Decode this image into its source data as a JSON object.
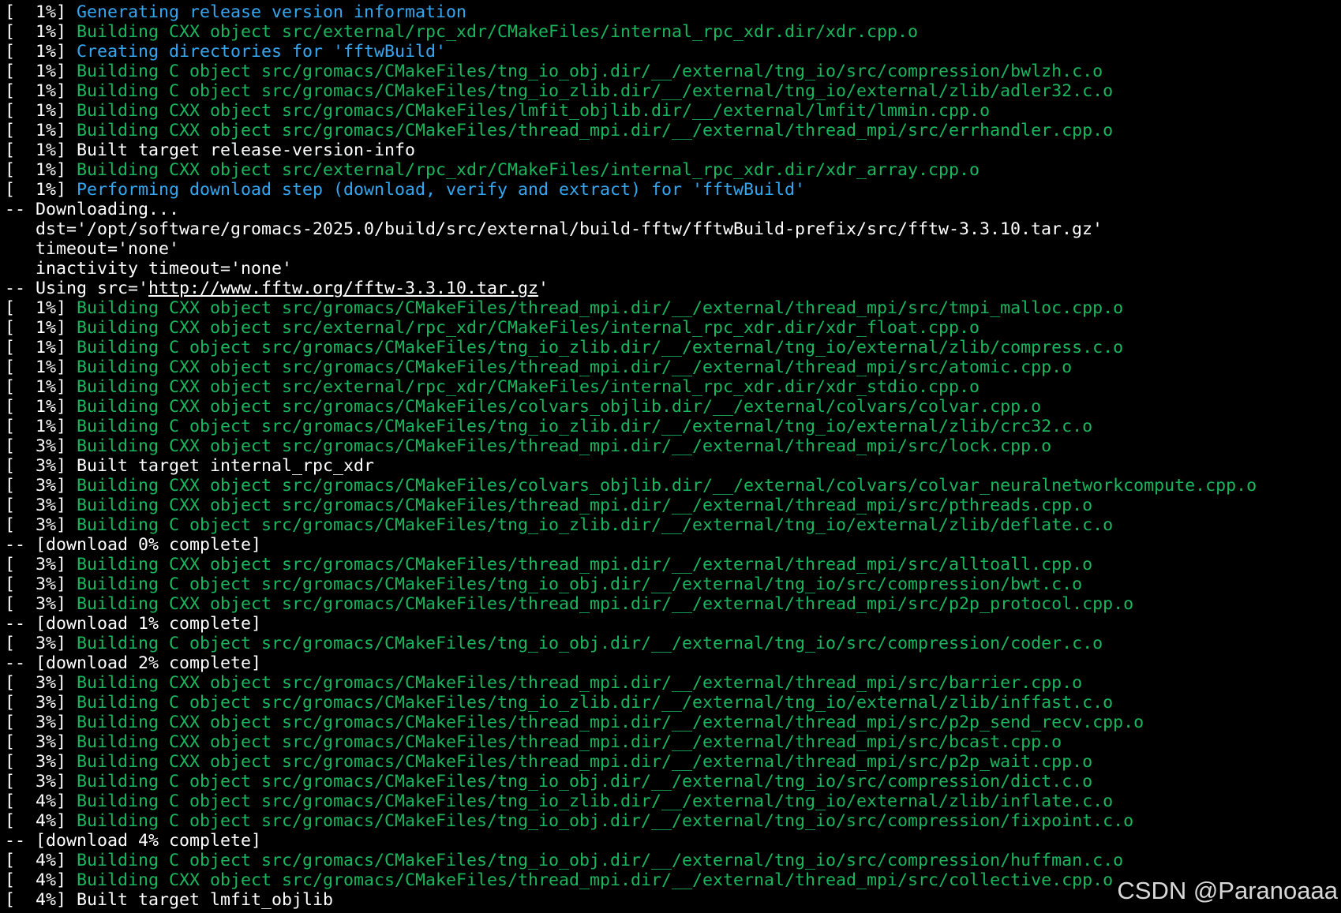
{
  "watermark": "CSDN @Paranoaaa",
  "colors": {
    "background": "#000000",
    "white": "#ffffff",
    "green": "#1ab75e",
    "blue": "#35a7f0"
  },
  "lines": [
    [
      {
        "c": "white",
        "t": "[  1%] "
      },
      {
        "c": "blue",
        "t": "Generating release version information"
      }
    ],
    [
      {
        "c": "white",
        "t": "[  1%] "
      },
      {
        "c": "green",
        "t": "Building CXX object src/external/rpc_xdr/CMakeFiles/internal_rpc_xdr.dir/xdr.cpp.o"
      }
    ],
    [
      {
        "c": "white",
        "t": "[  1%] "
      },
      {
        "c": "blue",
        "t": "Creating directories for 'fftwBuild'"
      }
    ],
    [
      {
        "c": "white",
        "t": "[  1%] "
      },
      {
        "c": "green",
        "t": "Building C object src/gromacs/CMakeFiles/tng_io_obj.dir/__/external/tng_io/src/compression/bwlzh.c.o"
      }
    ],
    [
      {
        "c": "white",
        "t": "[  1%] "
      },
      {
        "c": "green",
        "t": "Building C object src/gromacs/CMakeFiles/tng_io_zlib.dir/__/external/tng_io/external/zlib/adler32.c.o"
      }
    ],
    [
      {
        "c": "white",
        "t": "[  1%] "
      },
      {
        "c": "green",
        "t": "Building CXX object src/gromacs/CMakeFiles/lmfit_objlib.dir/__/external/lmfit/lmmin.cpp.o"
      }
    ],
    [
      {
        "c": "white",
        "t": "[  1%] "
      },
      {
        "c": "green",
        "t": "Building CXX object src/gromacs/CMakeFiles/thread_mpi.dir/__/external/thread_mpi/src/errhandler.cpp.o"
      }
    ],
    [
      {
        "c": "white",
        "t": "[  1%] Built target release-version-info"
      }
    ],
    [
      {
        "c": "white",
        "t": "[  1%] "
      },
      {
        "c": "green",
        "t": "Building CXX object src/external/rpc_xdr/CMakeFiles/internal_rpc_xdr.dir/xdr_array.cpp.o"
      }
    ],
    [
      {
        "c": "white",
        "t": "[  1%] "
      },
      {
        "c": "blue",
        "t": "Performing download step (download, verify and extract) for 'fftwBuild'"
      }
    ],
    [
      {
        "c": "white",
        "t": "-- Downloading..."
      }
    ],
    [
      {
        "c": "white",
        "t": "   dst='/opt/software/gromacs-2025.0/build/src/external/build-fftw/fftwBuild-prefix/src/fftw-3.3.10.tar.gz'"
      }
    ],
    [
      {
        "c": "white",
        "t": "   timeout='none'"
      }
    ],
    [
      {
        "c": "white",
        "t": "   inactivity timeout='none'"
      }
    ],
    [
      {
        "c": "white",
        "t": "-- Using src='"
      },
      {
        "c": "link",
        "t": "http://www.fftw.org/fftw-3.3.10.tar.gz"
      },
      {
        "c": "white",
        "t": "'"
      }
    ],
    [
      {
        "c": "white",
        "t": "[  1%] "
      },
      {
        "c": "green",
        "t": "Building CXX object src/gromacs/CMakeFiles/thread_mpi.dir/__/external/thread_mpi/src/tmpi_malloc.cpp.o"
      }
    ],
    [
      {
        "c": "white",
        "t": "[  1%] "
      },
      {
        "c": "green",
        "t": "Building CXX object src/external/rpc_xdr/CMakeFiles/internal_rpc_xdr.dir/xdr_float.cpp.o"
      }
    ],
    [
      {
        "c": "white",
        "t": "[  1%] "
      },
      {
        "c": "green",
        "t": "Building C object src/gromacs/CMakeFiles/tng_io_zlib.dir/__/external/tng_io/external/zlib/compress.c.o"
      }
    ],
    [
      {
        "c": "white",
        "t": "[  1%] "
      },
      {
        "c": "green",
        "t": "Building CXX object src/gromacs/CMakeFiles/thread_mpi.dir/__/external/thread_mpi/src/atomic.cpp.o"
      }
    ],
    [
      {
        "c": "white",
        "t": "[  1%] "
      },
      {
        "c": "green",
        "t": "Building CXX object src/external/rpc_xdr/CMakeFiles/internal_rpc_xdr.dir/xdr_stdio.cpp.o"
      }
    ],
    [
      {
        "c": "white",
        "t": "[  1%] "
      },
      {
        "c": "green",
        "t": "Building CXX object src/gromacs/CMakeFiles/colvars_objlib.dir/__/external/colvars/colvar.cpp.o"
      }
    ],
    [
      {
        "c": "white",
        "t": "[  1%] "
      },
      {
        "c": "green",
        "t": "Building C object src/gromacs/CMakeFiles/tng_io_zlib.dir/__/external/tng_io/external/zlib/crc32.c.o"
      }
    ],
    [
      {
        "c": "white",
        "t": "[  3%] "
      },
      {
        "c": "green",
        "t": "Building CXX object src/gromacs/CMakeFiles/thread_mpi.dir/__/external/thread_mpi/src/lock.cpp.o"
      }
    ],
    [
      {
        "c": "white",
        "t": "[  3%] Built target internal_rpc_xdr"
      }
    ],
    [
      {
        "c": "white",
        "t": "[  3%] "
      },
      {
        "c": "green",
        "t": "Building CXX object src/gromacs/CMakeFiles/colvars_objlib.dir/__/external/colvars/colvar_neuralnetworkcompute.cpp.o"
      }
    ],
    [
      {
        "c": "white",
        "t": "[  3%] "
      },
      {
        "c": "green",
        "t": "Building CXX object src/gromacs/CMakeFiles/thread_mpi.dir/__/external/thread_mpi/src/pthreads.cpp.o"
      }
    ],
    [
      {
        "c": "white",
        "t": "[  3%] "
      },
      {
        "c": "green",
        "t": "Building C object src/gromacs/CMakeFiles/tng_io_zlib.dir/__/external/tng_io/external/zlib/deflate.c.o"
      }
    ],
    [
      {
        "c": "white",
        "t": "-- [download 0% complete]"
      }
    ],
    [
      {
        "c": "white",
        "t": "[  3%] "
      },
      {
        "c": "green",
        "t": "Building CXX object src/gromacs/CMakeFiles/thread_mpi.dir/__/external/thread_mpi/src/alltoall.cpp.o"
      }
    ],
    [
      {
        "c": "white",
        "t": "[  3%] "
      },
      {
        "c": "green",
        "t": "Building C object src/gromacs/CMakeFiles/tng_io_obj.dir/__/external/tng_io/src/compression/bwt.c.o"
      }
    ],
    [
      {
        "c": "white",
        "t": "[  3%] "
      },
      {
        "c": "green",
        "t": "Building CXX object src/gromacs/CMakeFiles/thread_mpi.dir/__/external/thread_mpi/src/p2p_protocol.cpp.o"
      }
    ],
    [
      {
        "c": "white",
        "t": "-- [download 1% complete]"
      }
    ],
    [
      {
        "c": "white",
        "t": "[  3%] "
      },
      {
        "c": "green",
        "t": "Building C object src/gromacs/CMakeFiles/tng_io_obj.dir/__/external/tng_io/src/compression/coder.c.o"
      }
    ],
    [
      {
        "c": "white",
        "t": "-- [download 2% complete]"
      }
    ],
    [
      {
        "c": "white",
        "t": "[  3%] "
      },
      {
        "c": "green",
        "t": "Building CXX object src/gromacs/CMakeFiles/thread_mpi.dir/__/external/thread_mpi/src/barrier.cpp.o"
      }
    ],
    [
      {
        "c": "white",
        "t": "[  3%] "
      },
      {
        "c": "green",
        "t": "Building C object src/gromacs/CMakeFiles/tng_io_zlib.dir/__/external/tng_io/external/zlib/inffast.c.o"
      }
    ],
    [
      {
        "c": "white",
        "t": "[  3%] "
      },
      {
        "c": "green",
        "t": "Building CXX object src/gromacs/CMakeFiles/thread_mpi.dir/__/external/thread_mpi/src/p2p_send_recv.cpp.o"
      }
    ],
    [
      {
        "c": "white",
        "t": "[  3%] "
      },
      {
        "c": "green",
        "t": "Building CXX object src/gromacs/CMakeFiles/thread_mpi.dir/__/external/thread_mpi/src/bcast.cpp.o"
      }
    ],
    [
      {
        "c": "white",
        "t": "[  3%] "
      },
      {
        "c": "green",
        "t": "Building CXX object src/gromacs/CMakeFiles/thread_mpi.dir/__/external/thread_mpi/src/p2p_wait.cpp.o"
      }
    ],
    [
      {
        "c": "white",
        "t": "[  3%] "
      },
      {
        "c": "green",
        "t": "Building C object src/gromacs/CMakeFiles/tng_io_obj.dir/__/external/tng_io/src/compression/dict.c.o"
      }
    ],
    [
      {
        "c": "white",
        "t": "[  4%] "
      },
      {
        "c": "green",
        "t": "Building C object src/gromacs/CMakeFiles/tng_io_zlib.dir/__/external/tng_io/external/zlib/inflate.c.o"
      }
    ],
    [
      {
        "c": "white",
        "t": "[  4%] "
      },
      {
        "c": "green",
        "t": "Building C object src/gromacs/CMakeFiles/tng_io_obj.dir/__/external/tng_io/src/compression/fixpoint.c.o"
      }
    ],
    [
      {
        "c": "white",
        "t": "-- [download 4% complete]"
      }
    ],
    [
      {
        "c": "white",
        "t": "[  4%] "
      },
      {
        "c": "green",
        "t": "Building C object src/gromacs/CMakeFiles/tng_io_obj.dir/__/external/tng_io/src/compression/huffman.c.o"
      }
    ],
    [
      {
        "c": "white",
        "t": "[  4%] "
      },
      {
        "c": "green",
        "t": "Building CXX object src/gromacs/CMakeFiles/thread_mpi.dir/__/external/thread_mpi/src/collective.cpp.o"
      }
    ],
    [
      {
        "c": "white",
        "t": "[  4%] Built target lmfit_objlib"
      }
    ]
  ]
}
